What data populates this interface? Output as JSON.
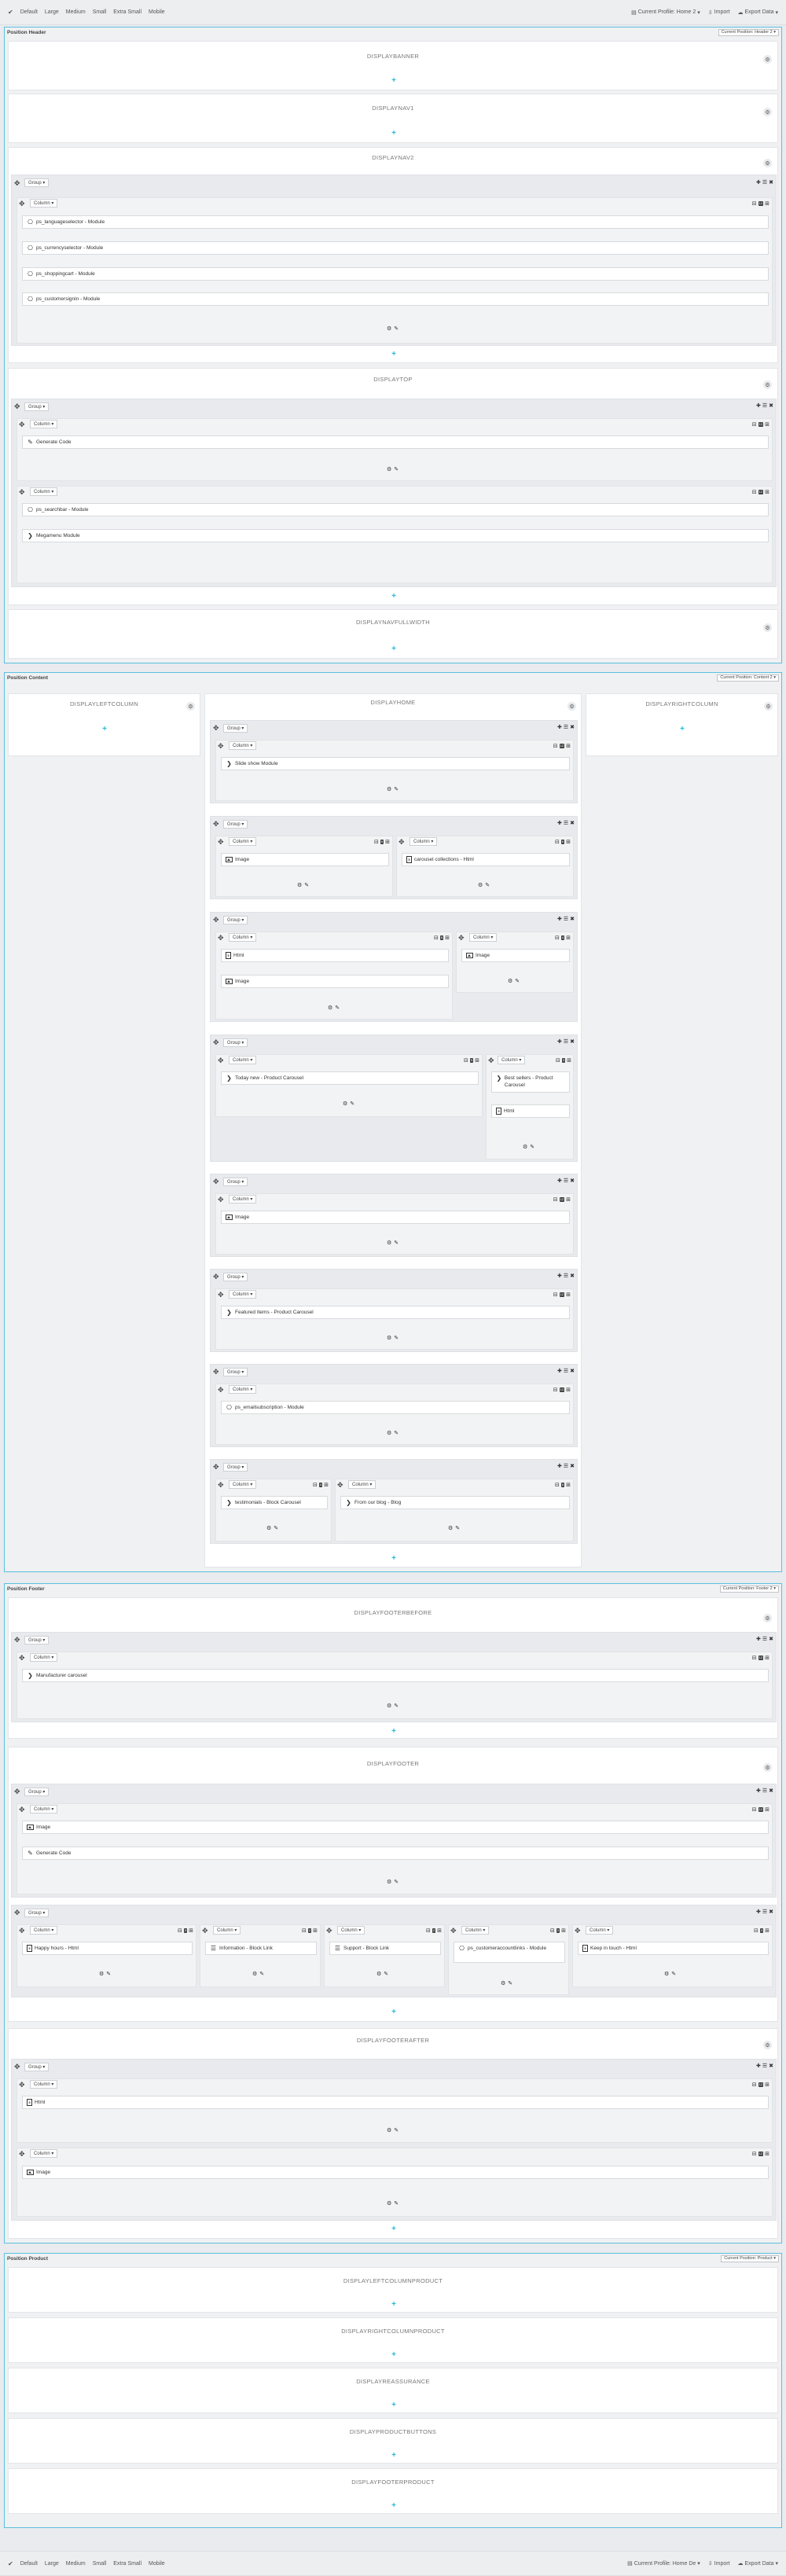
{
  "toolbar": {
    "devices": [
      "Default",
      "Large",
      "Medium",
      "Small",
      "Extra Small",
      "Mobile"
    ],
    "profile": "Current Profile: Home 2",
    "profile_bottom": "Current Profile: Home De",
    "import": "Import",
    "export": "Export Data"
  },
  "sections": {
    "header": {
      "title": "Position Header",
      "selector": "Current Position: Header 2"
    },
    "content": {
      "title": "Position Content",
      "selector": "Current Position: Content 2"
    },
    "footer": {
      "title": "Position Footer",
      "selector": "Current Position: Footer 2"
    },
    "product": {
      "title": "Position Product",
      "selector": "Current Position: Product"
    }
  },
  "hooks": {
    "banner": "DISPLAYBANNER",
    "nav1": "DISPLAYNAV1",
    "nav2": "DISPLAYNAV2",
    "top": "DISPLAYTOP",
    "navfullwidth": "DISPLAYNAVFULLWIDTH",
    "leftcolumn": "DISPLAYLEFTCOLUMN",
    "home": "DISPLAYHOME",
    "rightcolumn": "DISPLAYRIGHTCOLUMN",
    "footerbefore": "DISPLAYFOOTERBEFORE",
    "footer": "DISPLAYFOOTER",
    "footerafter": "DISPLAYFOOTERAFTER",
    "leftcolumnproduct": "DISPLAYLEFTCOLUMNPRODUCT",
    "rightcolumnproduct": "DISPLAYRIGHTCOLUMNPRODUCT",
    "reassurance": "DISPLAYREASSURANCE",
    "productbuttons": "DISPLAYPRODUCTBUTTONS",
    "footerproduct": "DISPLAYFOOTERPRODUCT"
  },
  "labels": {
    "group": "Group",
    "column": "Column"
  },
  "modules": {
    "lang": "ps_languageselector - Module",
    "currency": "ps_currencyselector - Module",
    "cart": "ps_shoppingcart - Module",
    "signin": "ps_customersignin - Module",
    "gencode": "Generate Code",
    "search": "ps_searchbar - Module",
    "megamenu": "Megamenu Module",
    "slideshow": "Slide show Module",
    "image": "Image",
    "carousel_coll": "carousel collections - Html",
    "html": "Html",
    "today_new": "Today new - Product Carousel",
    "best_sellers": "Best sellers - Product Carousel",
    "featured": "Featured Items - Product Carousel",
    "emailsub": "ps_emailsubscription - Module",
    "testimonials": "testimonials - Block Carousel",
    "blog": "From our blog - Blog",
    "manufacturer": "Manufacturer carousel",
    "happy_hours": "Happy hours - Html",
    "information": "Information - Block Link",
    "support": "Support - Block Link",
    "account_links": "ps_customeraccountlinks - Module",
    "keep_touch": "Keep in touch - Html"
  }
}
